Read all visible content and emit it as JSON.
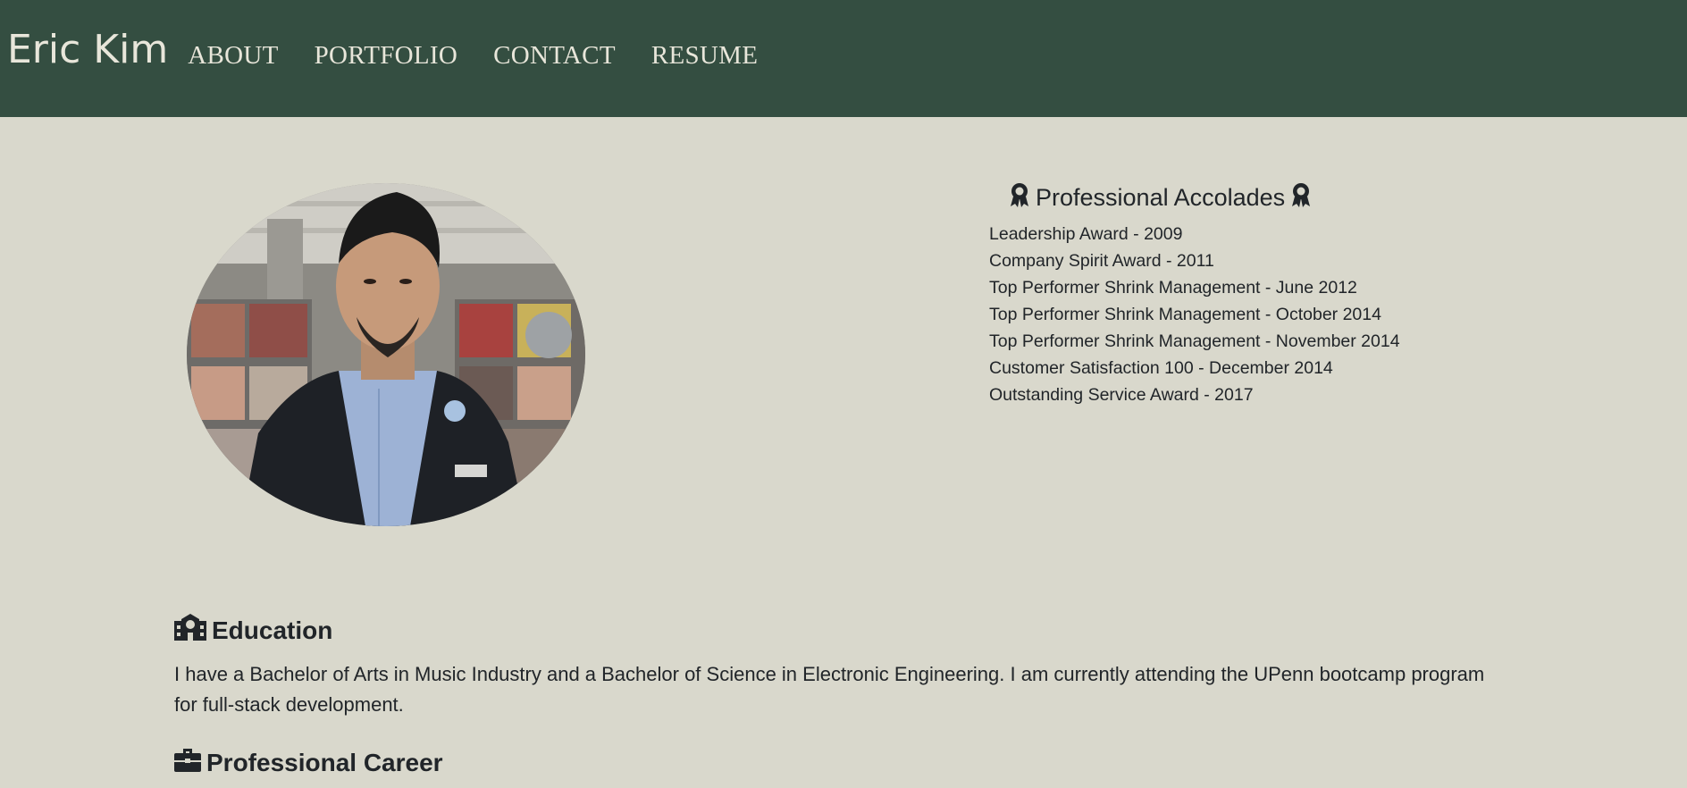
{
  "header": {
    "brand": "Eric Kim",
    "nav": [
      {
        "label": "ABOUT"
      },
      {
        "label": "PORTFOLIO"
      },
      {
        "label": "CONTACT"
      },
      {
        "label": "RESUME"
      }
    ]
  },
  "colors": {
    "header_bg": "#344e41",
    "page_bg": "#d9d8cc",
    "nav_text": "#e8e6da"
  },
  "accolades": {
    "title": "Professional Accolades",
    "icon": "award-icon",
    "items": [
      "Leadership Award - 2009",
      "Company Spirit Award - 2011",
      "Top Performer Shrink Management - June 2012",
      "Top Performer Shrink Management - October 2014",
      "Top Performer Shrink Management - November 2014",
      "Customer Satisfaction 100 - December 2014",
      "Outstanding Service Award - 2017"
    ]
  },
  "education": {
    "icon": "school-icon",
    "title": "Education",
    "text": "I have a Bachelor of Arts in Music Industry and a Bachelor of Science in Electronic Engineering. I am currently attending the UPenn bootcamp program for full-stack development."
  },
  "career": {
    "icon": "briefcase-icon",
    "title": "Professional Career"
  }
}
